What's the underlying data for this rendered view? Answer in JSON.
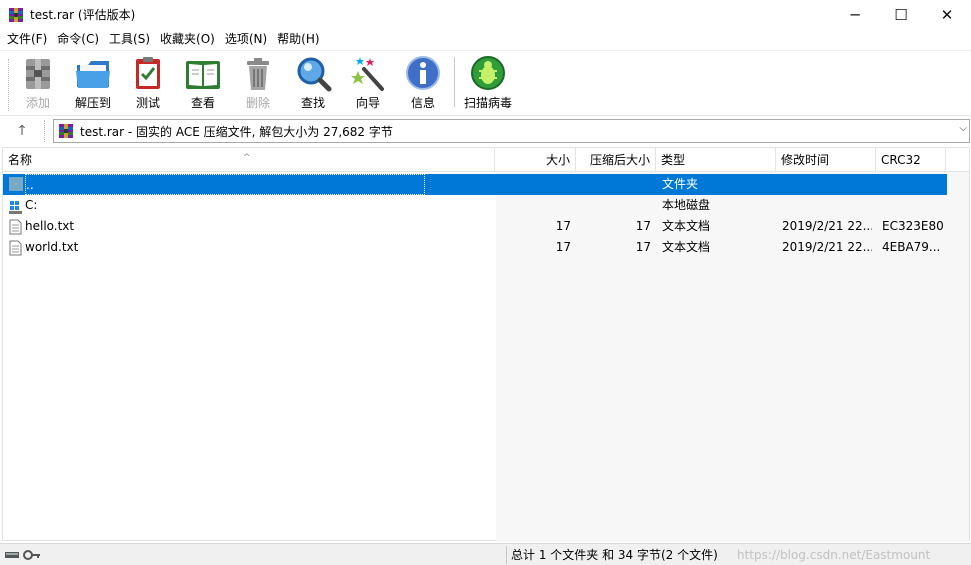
{
  "window": {
    "title": "test.rar (评估版本)",
    "controls": {
      "minimize": "─",
      "maximize": "☐",
      "close": "✕"
    }
  },
  "menu": [
    "文件(F)",
    "命令(C)",
    "工具(S)",
    "收藏夹(O)",
    "选项(N)",
    "帮助(H)"
  ],
  "toolbar": [
    {
      "label": "添加",
      "icon": "add-archive-icon",
      "enabled": false
    },
    {
      "label": "解压到",
      "icon": "extract-to-folder-icon",
      "enabled": true
    },
    {
      "label": "测试",
      "icon": "test-clipboard-icon",
      "enabled": true
    },
    {
      "label": "查看",
      "icon": "view-book-icon",
      "enabled": true
    },
    {
      "label": "删除",
      "icon": "trash-can-icon",
      "enabled": false
    },
    {
      "label": "查找",
      "icon": "magnifier-icon",
      "enabled": true
    },
    {
      "label": "向导",
      "icon": "wizard-wand-icon",
      "enabled": true
    },
    {
      "label": "信息",
      "icon": "info-icon",
      "enabled": true
    },
    {
      "label": "扫描病毒",
      "icon": "virus-scan-icon",
      "enabled": true
    }
  ],
  "address": {
    "up_icon": "↑",
    "text": "test.rar - 固实的 ACE 压缩文件, 解包大小为 27,682 字节",
    "dropdown_icon": "⌵"
  },
  "list": {
    "columns": [
      "名称",
      "大小",
      "压缩后大小",
      "类型",
      "修改时间",
      "CRC32"
    ],
    "sort_arrow": "^",
    "rows": [
      {
        "name": "..",
        "size": "",
        "packed": "",
        "type": "文件夹",
        "modified": "",
        "crc": "",
        "icon": "folder-up-icon",
        "selected": true
      },
      {
        "name": "C:",
        "size": "",
        "packed": "",
        "type": "本地磁盘",
        "modified": "",
        "crc": "",
        "icon": "drive-icon",
        "selected": false
      },
      {
        "name": "hello.txt",
        "size": "17",
        "packed": "17",
        "type": "文本文档",
        "modified": "2019/2/21 22...",
        "crc": "EC323E80",
        "icon": "text-file-icon",
        "selected": false
      },
      {
        "name": "world.txt",
        "size": "17",
        "packed": "17",
        "type": "文本文档",
        "modified": "2019/2/21 22...",
        "crc": "4EBA79...",
        "icon": "text-file-icon",
        "selected": false
      }
    ]
  },
  "status": {
    "summary": "总计 1 个文件夹 和 34 字节(2 个文件)",
    "watermark": "https://blog.csdn.net/Eastmount"
  },
  "colors": {
    "selection": "#0078d7",
    "toolbar_disabled": "#a8a8a8"
  }
}
